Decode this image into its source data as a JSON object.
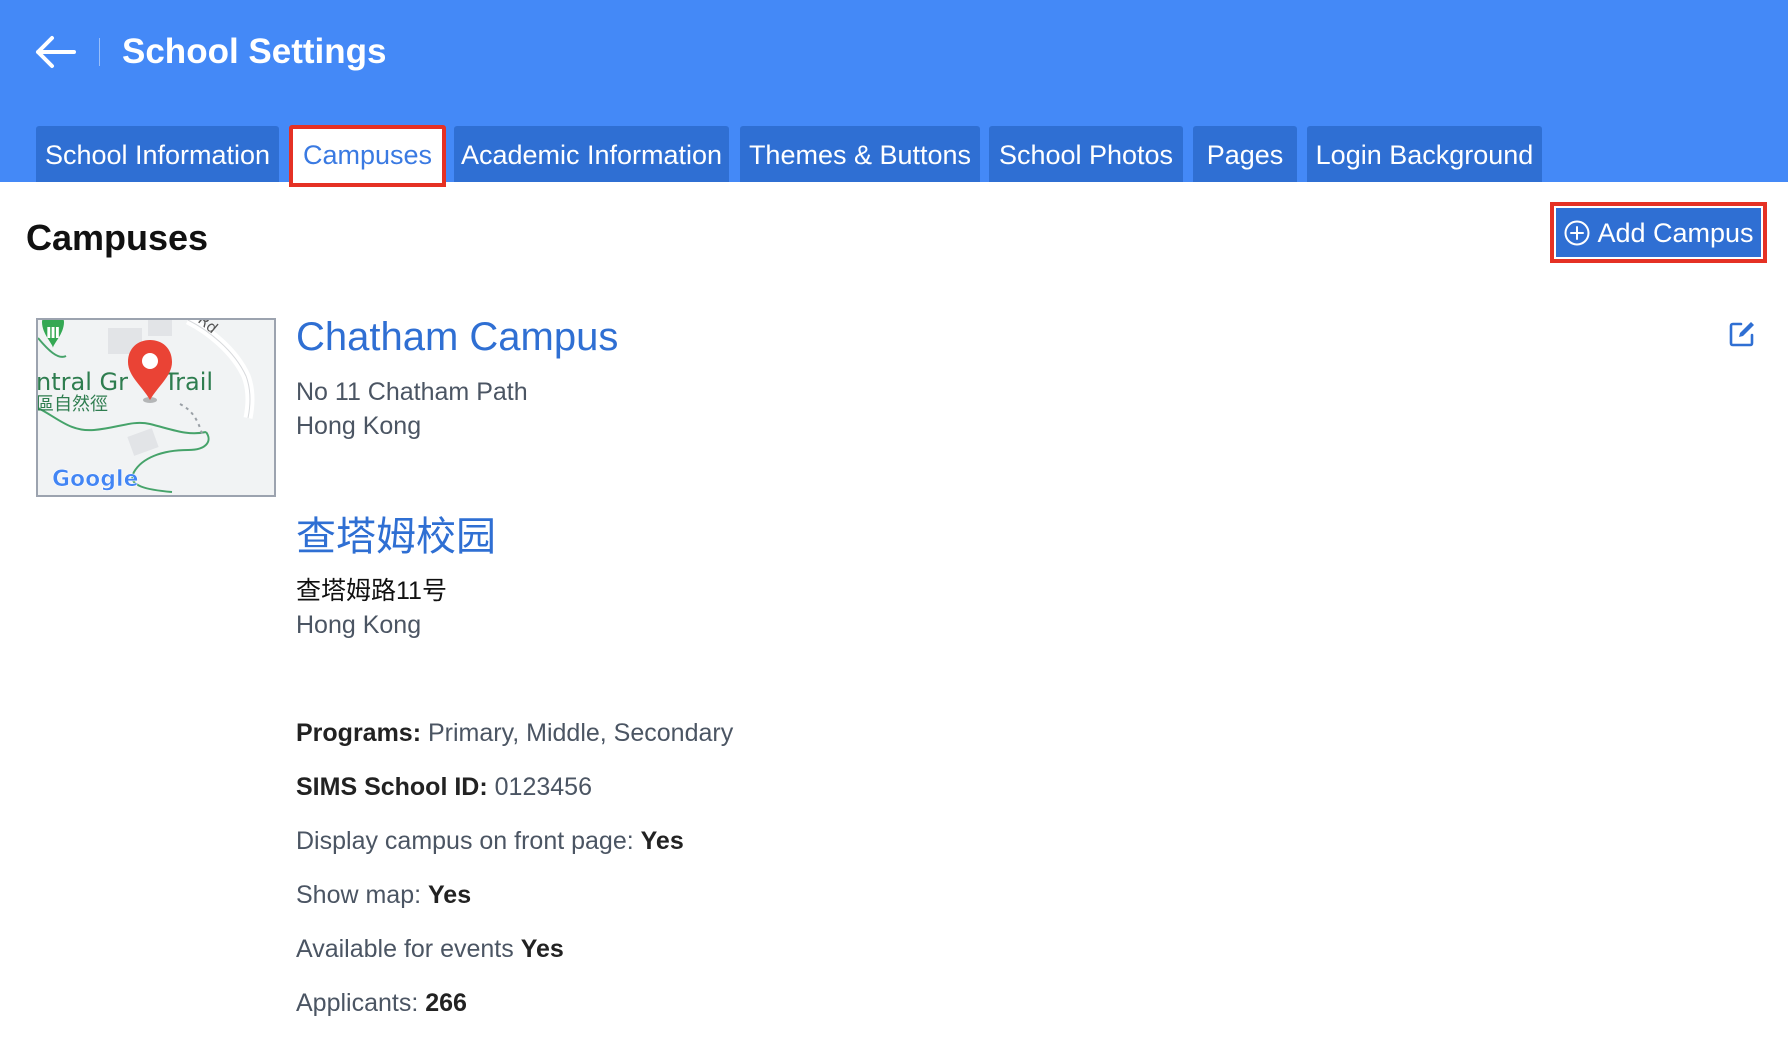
{
  "header": {
    "title": "School Settings",
    "back_icon": "arrow-left-icon",
    "background_color": "#4489f7"
  },
  "tabs": [
    {
      "label": "School Information",
      "active": false
    },
    {
      "label": "Campuses",
      "active": true
    },
    {
      "label": "Academic Information",
      "active": false
    },
    {
      "label": "Themes & Buttons",
      "active": false
    },
    {
      "label": "School Photos",
      "active": false
    },
    {
      "label": "Pages",
      "active": false
    },
    {
      "label": "Login Background",
      "active": false
    }
  ],
  "section": {
    "title": "Campuses",
    "add_button_label": "Add Campus",
    "add_button_icon": "plus-circle-icon"
  },
  "campus": {
    "name": "Chatham Campus",
    "address_line1": "No 11 Chatham Path",
    "address_line2": "Hong Kong",
    "name_cn": "查塔姆校园",
    "address_cn_line1": "查塔姆路11号",
    "address_cn_line2": "Hong Kong",
    "map": {
      "label_trail": "ntral Gr",
      "label_trail_end": "Trail",
      "label_cn": "區自然徑",
      "label_road": "y Rd",
      "logo_text": "Google"
    },
    "edit_icon": "edit-square-icon",
    "programs_label": "Programs:",
    "programs_value": "Primary, Middle, Secondary",
    "sims_label": "SIMS School ID:",
    "sims_value": "0123456",
    "display_label": "Display campus on front page:",
    "display_value": "Yes",
    "show_map_label": "Show map:",
    "show_map_value": "Yes",
    "events_label": "Available for events",
    "events_value": "Yes",
    "applicants_label": "Applicants:",
    "applicants_value": "266"
  },
  "colors": {
    "accent": "#2f6fd3",
    "highlight": "#e53124"
  }
}
